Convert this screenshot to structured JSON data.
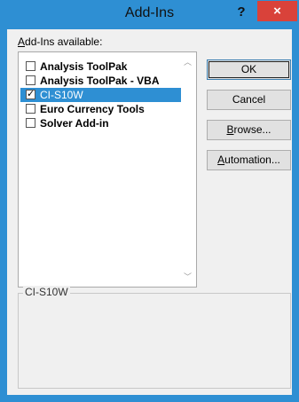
{
  "window": {
    "title": "Add-Ins",
    "help_label": "?",
    "close_label": "×"
  },
  "list": {
    "label_prefix": "A",
    "label_rest": "dd-Ins available:",
    "items": [
      {
        "label": "Analysis ToolPak",
        "checked": false,
        "selected": false
      },
      {
        "label": "Analysis ToolPak - VBA",
        "checked": false,
        "selected": false
      },
      {
        "label": "CI-S10W",
        "checked": true,
        "selected": true
      },
      {
        "label": "Euro Currency Tools",
        "checked": false,
        "selected": false
      },
      {
        "label": "Solver Add-in",
        "checked": false,
        "selected": false
      }
    ],
    "scroll_up_icon": "chevron-up-icon",
    "scroll_down_icon": "chevron-down-icon"
  },
  "buttons": {
    "ok": "OK",
    "cancel": "Cancel",
    "browse_prefix": "B",
    "browse_rest": "rowse...",
    "automation_prefix": "A",
    "automation_rest": "utomation..."
  },
  "description": {
    "title": "CI-S10W"
  },
  "colors": {
    "accent": "#2e8fd3",
    "close": "#d9423a"
  }
}
